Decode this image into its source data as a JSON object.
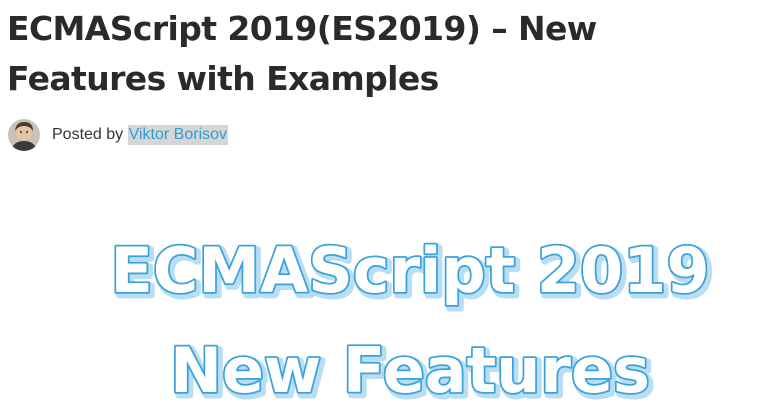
{
  "article": {
    "title": "ECMAScript 2019(ES2019) – New Features with Examples",
    "byline_prefix": "Posted by",
    "author": "Viktor Borisov"
  },
  "featured_image": {
    "line1": "ECMAScript 2019",
    "line2": "New Features",
    "outline_color": "#3aa2dc",
    "fill_color": "#ffffff"
  },
  "colors": {
    "title": "#2a2a2a",
    "link": "#2aa1d3",
    "link_highlight": "#d6d6d6"
  },
  "icons": {
    "avatar": "author-avatar-photo"
  }
}
